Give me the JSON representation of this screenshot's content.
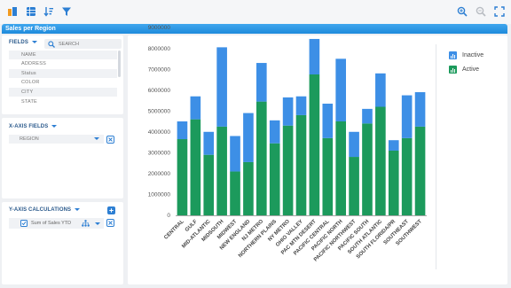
{
  "titlebar": {
    "title": "Sales per Region"
  },
  "fields": {
    "header": "FIELDS",
    "search_placeholder": "SEARCH",
    "items": [
      "NAME",
      "ADDRESS",
      "Status",
      "COLOR",
      "CITY",
      "STATE"
    ]
  },
  "xaxis": {
    "header": "X-AXIS FIELDS",
    "value": "REGION"
  },
  "yaxis": {
    "header": "Y-AXIS CALCULATIONS",
    "calc_label": "Sum of Sales YTD"
  },
  "legend": {
    "inactive": "Inactive",
    "active": "Active"
  },
  "colors": {
    "active": "#1c9a5c",
    "inactive": "#3d8fe6",
    "accent": "#2d7fd3"
  },
  "icons": [
    "layout-icon",
    "table-icon",
    "sort-icon",
    "filter-icon",
    "zoom-in-icon",
    "zoom-out-icon",
    "fullscreen-icon"
  ],
  "chart_data": {
    "type": "bar",
    "stacked": true,
    "categories": [
      "CENTRAL",
      "GULF",
      "MID-ATLANTIC",
      "MIDSOUTH",
      "MIDWEST",
      "NEW ENGLAND",
      "NJ METRO",
      "NORTHERN PLAINS",
      "NY METRO",
      "OHIO VALLEY",
      "PAC MTN DESERT",
      "PACIFIC CENTRAL",
      "PACIFIC NORTH",
      "PACIFIC NORTHWEST",
      "PACIFIC SOUTH",
      "SOUTH ATLANTIC",
      "SOUTH FLORIDA/PR",
      "SOUTHEAST",
      "SOUTHWEST"
    ],
    "series": [
      {
        "name": "Active",
        "values": [
          3650000,
          4600000,
          2900000,
          4250000,
          2100000,
          2550000,
          5450000,
          3450000,
          4300000,
          4800000,
          6750000,
          3700000,
          4500000,
          2800000,
          4400000,
          5200000,
          3100000,
          3700000,
          4250000
        ]
      },
      {
        "name": "Inactive",
        "values": [
          850000,
          1100000,
          1100000,
          3800000,
          1700000,
          2350000,
          1850000,
          1100000,
          1350000,
          900000,
          1700000,
          1650000,
          3000000,
          1200000,
          700000,
          1600000,
          500000,
          2050000,
          1650000
        ]
      }
    ],
    "yticks": [
      "0",
      "1000000",
      "2000000",
      "3000000",
      "4000000",
      "5000000",
      "6000000",
      "7000000",
      "8000000",
      "9000000"
    ],
    "ylim": [
      0,
      9000000
    ],
    "legend_position": "top-right",
    "grid": false
  }
}
